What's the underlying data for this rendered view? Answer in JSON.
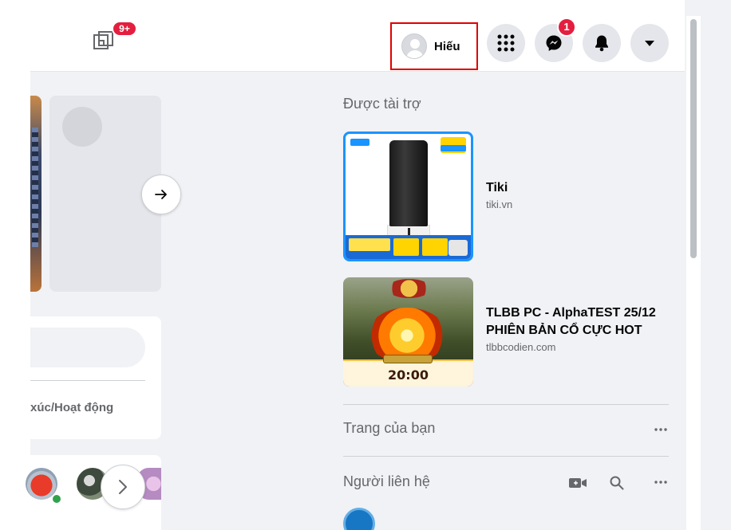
{
  "header": {
    "gaming_badge": "9+",
    "profile": {
      "name": "Hiếu"
    },
    "messenger_badge": "1",
    "icons": [
      "gaming-icon",
      "menu-grid-icon",
      "messenger-icon",
      "bell-icon",
      "caret-down-icon"
    ]
  },
  "right_column": {
    "sponsored_title": "Được tài trợ",
    "ads": [
      {
        "title": "Tiki",
        "domain": "tiki.vn"
      },
      {
        "title": "TLBB PC - AlphaTEST 25/12 PHIÊN BẢN CỔ CỰC HOT",
        "domain": "tlbbcodien.com",
        "image_time": "20:00"
      }
    ],
    "your_pages_title": "Trang của bạn",
    "contacts_title": "Người liên hệ"
  },
  "feed": {
    "composer_feeling_label": "xúc/Hoạt động"
  },
  "colors": {
    "badge": "#e41e3f",
    "highlight_box": "#e00000",
    "tiki_blue": "#1a94ff",
    "online": "#31a24c"
  }
}
